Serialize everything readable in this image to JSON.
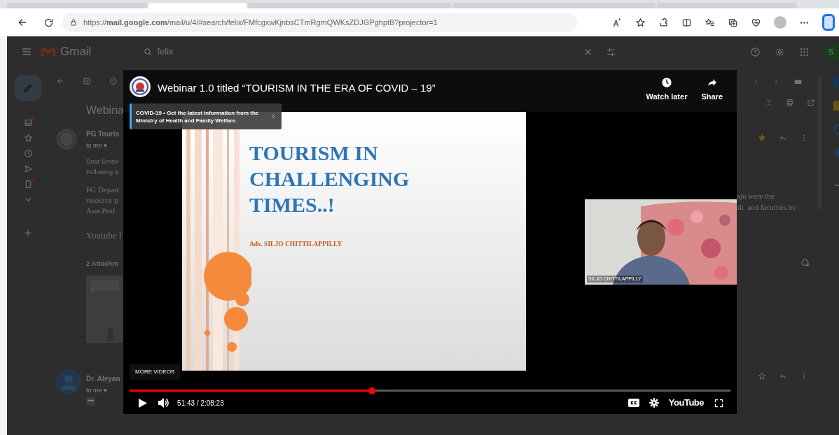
{
  "browser": {
    "tabs": [
      {
        "selected": false
      },
      {
        "selected": true
      },
      {
        "selected": false
      },
      {
        "selected": false
      },
      {
        "selected": false
      }
    ],
    "url": "https://**mail.google.com**/mail/u/4/#search/felix/FMfcgxwKjnbsCTmRgmQWKsZDJGPghptB?projector=1"
  },
  "gmail": {
    "app_name": "Gmail",
    "search_value": "felix",
    "account_initial": "S",
    "rail": [
      {
        "kind": "inbox",
        "dot": true
      },
      {
        "kind": "starred",
        "dot": false
      },
      {
        "kind": "snoozed",
        "dot": false
      },
      {
        "kind": "sent",
        "dot": false
      },
      {
        "kind": "drafts",
        "dot": true
      },
      {
        "kind": "more",
        "dot": false
      }
    ],
    "subject": "Webina",
    "messages": [
      {
        "sender": "PG Touris",
        "recipient": "to me ▾",
        "starred": true,
        "paragraphs": [
          {
            "kind": "plain",
            "lines": [
              "Dear Sreev",
              "Following is"
            ]
          },
          {
            "kind": "serif",
            "lines": [
              "PG Depart",
              "resource p",
              "Asst.Prof."
            ]
          },
          {
            "kind": "large",
            "lines": [
              "Youtube l"
            ]
          }
        ],
        "continued_lines": [
          "aju were the",
          "sh  and faculties by"
        ],
        "attachments_heading": "2 Attachm",
        "attachment": {
          "kind": "picture"
        }
      },
      {
        "sender": "Dr. Aleyan",
        "recipient": "to me ▾",
        "starred": false,
        "trimmed": "•••"
      }
    ]
  },
  "video": {
    "title": "Webinar 1.0 titled “TOURISM IN THE ERA OF COVID – 19”",
    "actions": [
      {
        "kind": "watch_later",
        "label": "Watch later"
      },
      {
        "kind": "share",
        "label": "Share"
      }
    ],
    "banner": "COVID-19 • Get the latest information from the Ministry of Health and Family Welfare.",
    "slide": {
      "title_lines": [
        "TOURISM IN",
        "CHALLENGING",
        "TIMES..!"
      ],
      "author": "Adv. SILJO CHITTILAPPILLY"
    },
    "webcam_name": "SILJO CHITTILAPPILLY",
    "more_videos": "MORE VIDEOS",
    "progress": {
      "level": 0.403
    },
    "time": "51:43 / 2:08:23",
    "logo": "YouTube"
  }
}
